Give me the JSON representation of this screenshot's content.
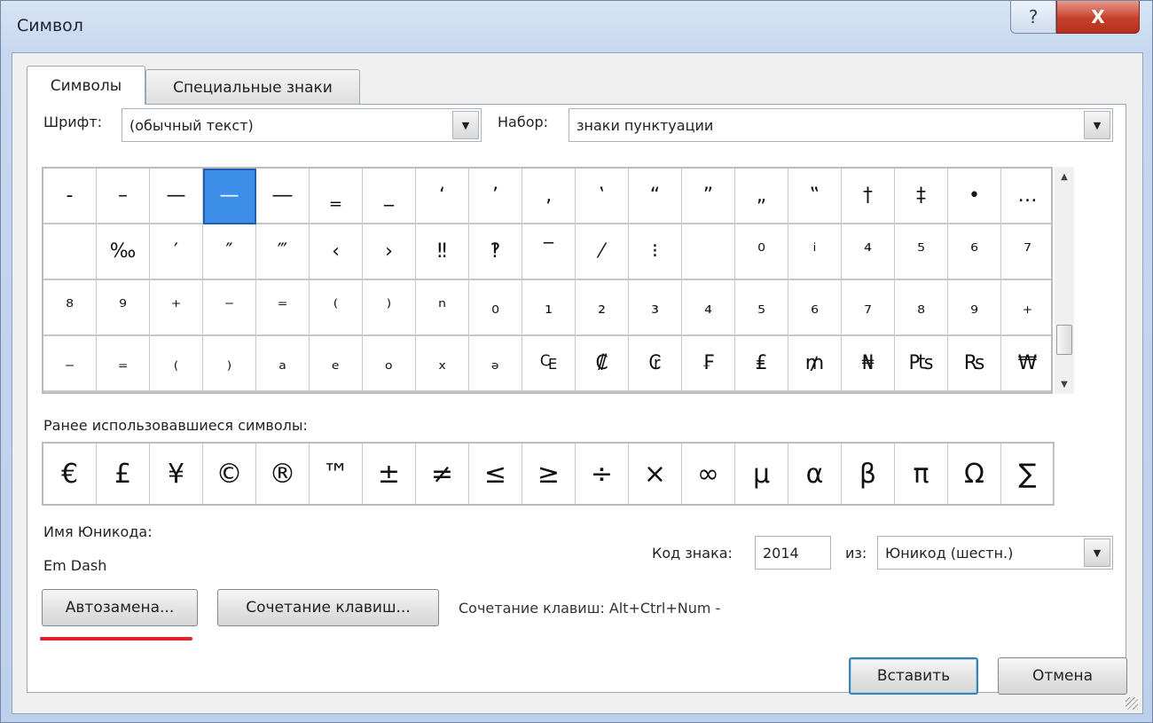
{
  "window": {
    "title": "Символ",
    "help_label": "?",
    "close_label": "X"
  },
  "tabs": [
    {
      "label": "Символы",
      "active": true
    },
    {
      "label": "Специальные знаки",
      "active": false
    }
  ],
  "font": {
    "label": "Шрифт:",
    "value": "(обычный текст)"
  },
  "subset": {
    "label": "Набор:",
    "value": "знаки пунктуации"
  },
  "symbols": [
    "‐",
    "–",
    "—",
    "—",
    "―",
    "‗",
    "_",
    "‘",
    "’",
    "‚",
    "‛",
    "“",
    "”",
    "„",
    "‟",
    "†",
    "‡",
    "•",
    "…",
    " ",
    "‰",
    "′",
    "″",
    "‴",
    "‹",
    "›",
    "‼",
    "‽",
    "‾",
    "⁄",
    "⁝",
    " ",
    "⁰",
    "ⁱ",
    "⁴",
    "⁵",
    "⁶",
    "⁷",
    "⁸",
    "⁹",
    "⁺",
    "⁻",
    "⁼",
    "⁽",
    "⁾",
    "ⁿ",
    "₀",
    "₁",
    "₂",
    "₃",
    "₄",
    "₅",
    "₆",
    "₇",
    "₈",
    "₉",
    "₊",
    "₋",
    "₌",
    "₍",
    "₎",
    "ₐ",
    "ₑ",
    "ₒ",
    "ₓ",
    "ₔ",
    "₠",
    "₡",
    "₢",
    "₣",
    "₤",
    "₥",
    "₦",
    "₧",
    "₨",
    "₩"
  ],
  "selected_index": 3,
  "recent": {
    "label": "Ранее использовавшиеся символы:",
    "symbols": [
      "€",
      "£",
      "¥",
      "©",
      "®",
      "™",
      "±",
      "≠",
      "≤",
      "≥",
      "÷",
      "×",
      "∞",
      "µ",
      "α",
      "β",
      "π",
      "Ω",
      "∑"
    ]
  },
  "unicode_name": {
    "label": "Имя Юникода:",
    "value": "Em Dash"
  },
  "char_code": {
    "label": "Код знака:",
    "value": "2014"
  },
  "from": {
    "label": "из:",
    "value": "Юникод (шестн.)"
  },
  "buttons": {
    "autocorrect": "Автозамена...",
    "shortcut_key": "Сочетание клавиш...",
    "insert": "Вставить",
    "cancel": "Отмена"
  },
  "shortcut_text": "Сочетание клавиш: Alt+Ctrl+Num -",
  "icons": {
    "dropdown": "▼",
    "scroll_up": "▲",
    "scroll_down": "▼"
  },
  "colors": {
    "selection": "#3d8ee8",
    "underline": "#e0232a"
  }
}
